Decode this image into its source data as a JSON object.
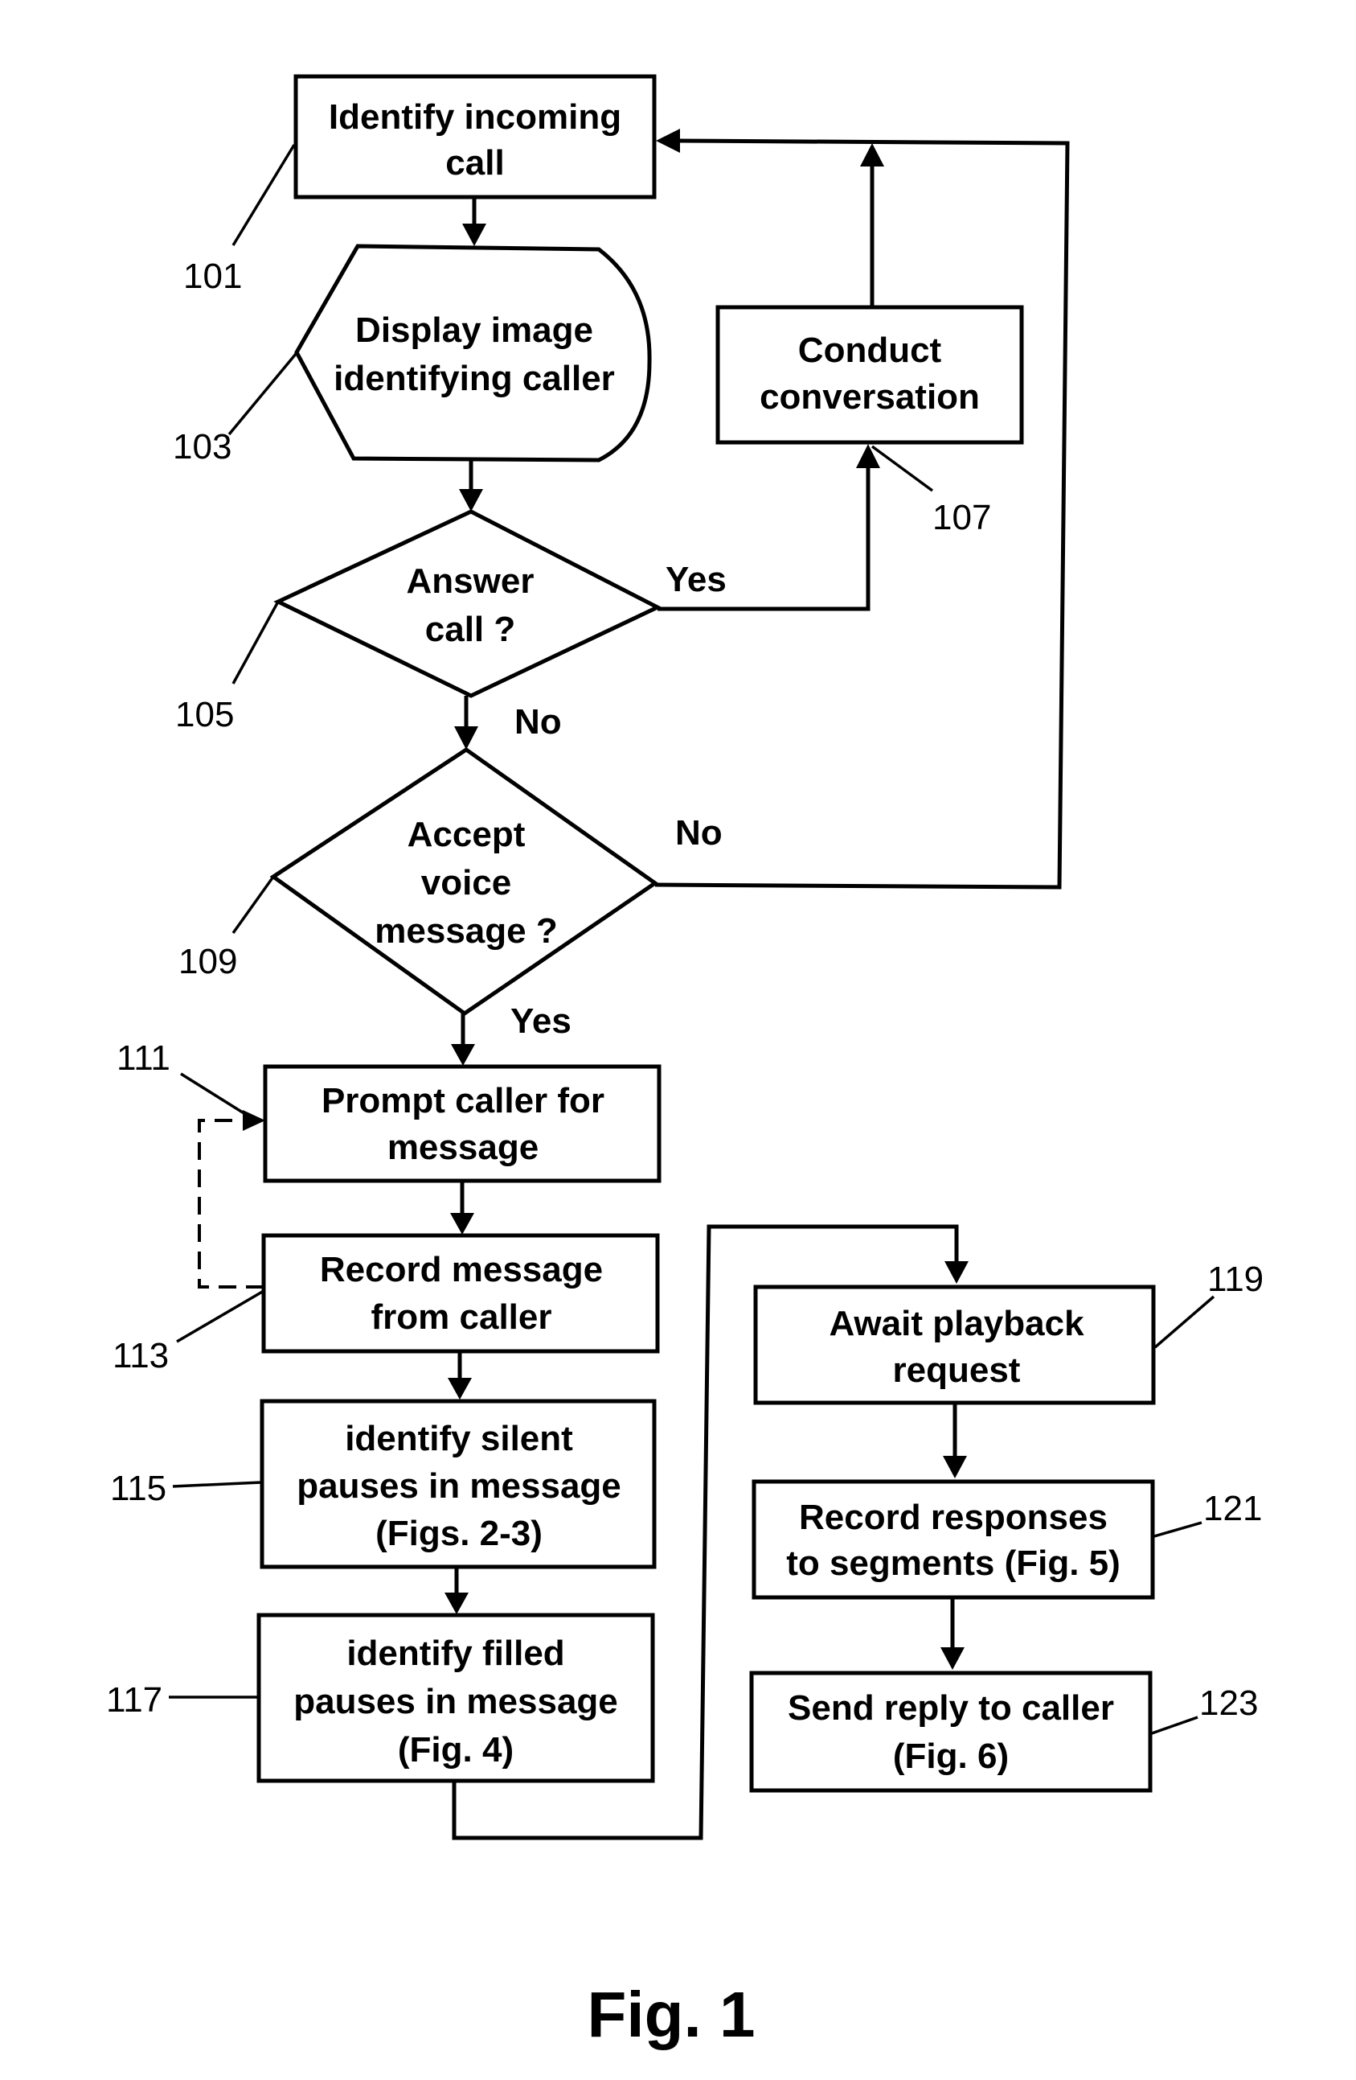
{
  "figure": {
    "caption": "Fig. 1",
    "nodes": {
      "n101": {
        "ref": "101",
        "lines": [
          "Identify incoming",
          "call"
        ]
      },
      "n103": {
        "ref": "103",
        "lines": [
          "Display image",
          "identifying caller"
        ]
      },
      "n105": {
        "ref": "105",
        "lines": [
          "Answer",
          "call ?"
        ]
      },
      "n107": {
        "ref": "107",
        "lines": [
          "Conduct",
          "conversation"
        ]
      },
      "n109": {
        "ref": "109",
        "lines": [
          "Accept",
          "voice",
          "message ?"
        ]
      },
      "n111": {
        "ref": "111",
        "lines": [
          "Prompt caller for",
          "message"
        ]
      },
      "n113": {
        "ref": "113",
        "lines": [
          "Record message",
          "from caller"
        ]
      },
      "n115": {
        "ref": "115",
        "lines": [
          "identify silent",
          "pauses in message",
          "(Figs. 2-3)"
        ]
      },
      "n117": {
        "ref": "117",
        "lines": [
          "identify filled",
          "pauses in message",
          "(Fig. 4)"
        ]
      },
      "n119": {
        "ref": "119",
        "lines": [
          "Await playback",
          "request"
        ]
      },
      "n121": {
        "ref": "121",
        "lines": [
          "Record responses",
          "to segments (Fig. 5)"
        ]
      },
      "n123": {
        "ref": "123",
        "lines": [
          "Send reply to caller",
          "(Fig. 6)"
        ]
      }
    },
    "edge_labels": {
      "answer_yes": "Yes",
      "answer_no": "No",
      "accept_no": "No",
      "accept_yes": "Yes"
    }
  }
}
